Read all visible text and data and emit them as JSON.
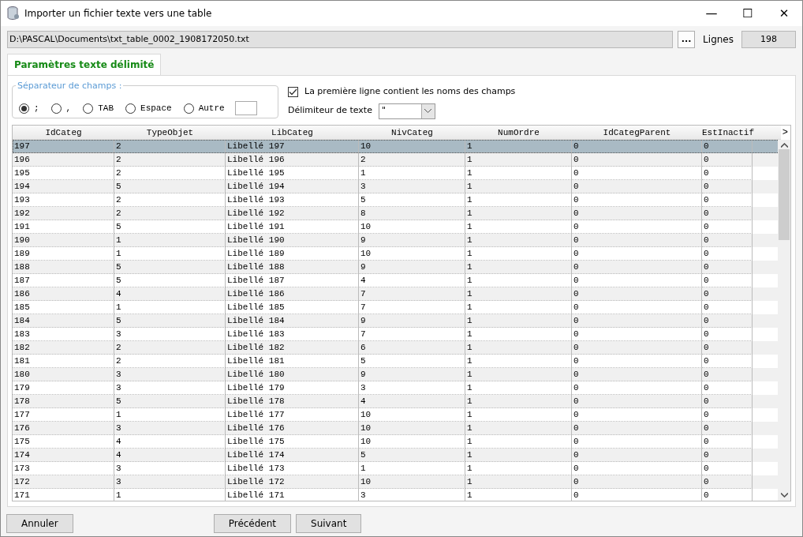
{
  "window": {
    "title": "Importer un fichier texte vers une table",
    "controls": [
      "—",
      "☐",
      "✕"
    ]
  },
  "file": {
    "path": "D:\\PASCAL\\Documents\\txt_table_0002_1908172050.txt",
    "browse": "...",
    "lines_label": "Lignes",
    "lines_value": "198"
  },
  "tabs": [
    {
      "label": "Paramètres texte délimité",
      "selected": true
    }
  ],
  "separator": {
    "legend": "Séparateur de champs :",
    "options": [
      {
        "label": ";",
        "selected": true
      },
      {
        "label": ",",
        "selected": false
      },
      {
        "label": "TAB",
        "selected": false
      },
      {
        "label": "Espace",
        "selected": false
      },
      {
        "label": "Autre",
        "selected": false
      }
    ]
  },
  "header_row": {
    "label": "La première ligne contient les noms des champs",
    "checked": true
  },
  "text_delimiter": {
    "label": "Délimiteur de texte",
    "value": "\""
  },
  "table": {
    "columns": [
      "IdCateg",
      "TypeObjet",
      "LibCateg",
      "NivCateg",
      "NumOrdre",
      "IdCategParent",
      "EstInactif"
    ],
    "scroll_right": ">",
    "rows": [
      {
        "cells": [
          "197",
          "2",
          "Libellé 197",
          "10",
          "1",
          "0",
          "0"
        ],
        "selected": true
      },
      {
        "cells": [
          "196",
          "2",
          "Libellé 196",
          "2",
          "1",
          "0",
          "0"
        ],
        "selected": false
      },
      {
        "cells": [
          "195",
          "2",
          "Libellé 195",
          "1",
          "1",
          "0",
          "0"
        ],
        "selected": false
      },
      {
        "cells": [
          "194",
          "5",
          "Libellé 194",
          "3",
          "1",
          "0",
          "0"
        ],
        "selected": false
      },
      {
        "cells": [
          "193",
          "2",
          "Libellé 193",
          "5",
          "1",
          "0",
          "0"
        ],
        "selected": false
      },
      {
        "cells": [
          "192",
          "2",
          "Libellé 192",
          "8",
          "1",
          "0",
          "0"
        ],
        "selected": false
      },
      {
        "cells": [
          "191",
          "5",
          "Libellé 191",
          "10",
          "1",
          "0",
          "0"
        ],
        "selected": false
      },
      {
        "cells": [
          "190",
          "1",
          "Libellé 190",
          "9",
          "1",
          "0",
          "0"
        ],
        "selected": false
      },
      {
        "cells": [
          "189",
          "1",
          "Libellé 189",
          "10",
          "1",
          "0",
          "0"
        ],
        "selected": false
      },
      {
        "cells": [
          "188",
          "5",
          "Libellé 188",
          "9",
          "1",
          "0",
          "0"
        ],
        "selected": false
      },
      {
        "cells": [
          "187",
          "5",
          "Libellé 187",
          "4",
          "1",
          "0",
          "0"
        ],
        "selected": false
      },
      {
        "cells": [
          "186",
          "4",
          "Libellé 186",
          "7",
          "1",
          "0",
          "0"
        ],
        "selected": false
      },
      {
        "cells": [
          "185",
          "1",
          "Libellé 185",
          "7",
          "1",
          "0",
          "0"
        ],
        "selected": false
      },
      {
        "cells": [
          "184",
          "5",
          "Libellé 184",
          "9",
          "1",
          "0",
          "0"
        ],
        "selected": false
      },
      {
        "cells": [
          "183",
          "3",
          "Libellé 183",
          "7",
          "1",
          "0",
          "0"
        ],
        "selected": false
      },
      {
        "cells": [
          "182",
          "2",
          "Libellé 182",
          "6",
          "1",
          "0",
          "0"
        ],
        "selected": false
      },
      {
        "cells": [
          "181",
          "2",
          "Libellé 181",
          "5",
          "1",
          "0",
          "0"
        ],
        "selected": false
      },
      {
        "cells": [
          "180",
          "3",
          "Libellé 180",
          "9",
          "1",
          "0",
          "0"
        ],
        "selected": false
      },
      {
        "cells": [
          "179",
          "3",
          "Libellé 179",
          "3",
          "1",
          "0",
          "0"
        ],
        "selected": false
      },
      {
        "cells": [
          "178",
          "5",
          "Libellé 178",
          "4",
          "1",
          "0",
          "0"
        ],
        "selected": false
      },
      {
        "cells": [
          "177",
          "1",
          "Libellé 177",
          "10",
          "1",
          "0",
          "0"
        ],
        "selected": false
      },
      {
        "cells": [
          "176",
          "3",
          "Libellé 176",
          "10",
          "1",
          "0",
          "0"
        ],
        "selected": false
      },
      {
        "cells": [
          "175",
          "4",
          "Libellé 175",
          "10",
          "1",
          "0",
          "0"
        ],
        "selected": false
      },
      {
        "cells": [
          "174",
          "4",
          "Libellé 174",
          "5",
          "1",
          "0",
          "0"
        ],
        "selected": false
      },
      {
        "cells": [
          "173",
          "3",
          "Libellé 173",
          "1",
          "1",
          "0",
          "0"
        ],
        "selected": false
      },
      {
        "cells": [
          "172",
          "3",
          "Libellé 172",
          "10",
          "1",
          "0",
          "0"
        ],
        "selected": false
      },
      {
        "cells": [
          "171",
          "1",
          "Libellé 171",
          "3",
          "1",
          "0",
          "0"
        ],
        "selected": false
      }
    ]
  },
  "buttons": [
    {
      "label": "Annuler",
      "kind": "cancel"
    },
    {
      "label": "Précédent",
      "kind": "nav"
    },
    {
      "label": "Suivant",
      "kind": "nav"
    }
  ]
}
